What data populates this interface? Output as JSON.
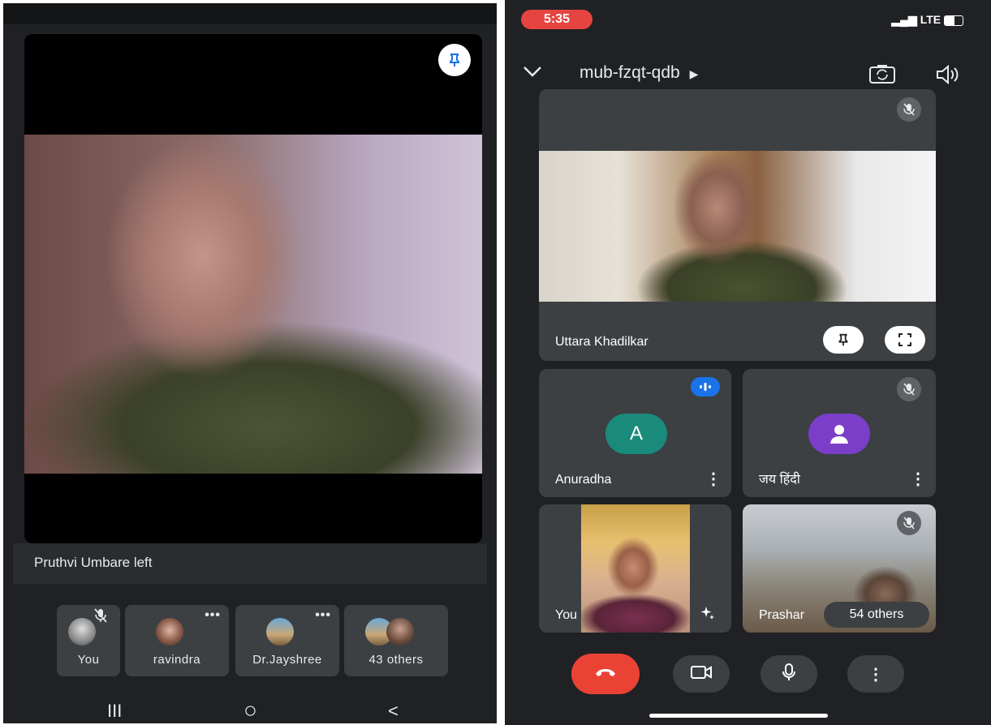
{
  "left_phone": {
    "notification": "Pruthvi Umbare left",
    "participants": [
      {
        "label": "You",
        "muted": true,
        "more": false
      },
      {
        "label": "ravindra",
        "muted": false,
        "more": true
      },
      {
        "label": "Dr.Jayshree",
        "muted": false,
        "more": true
      },
      {
        "label": "43 others",
        "muted": false,
        "more": false
      }
    ],
    "more_dots": "•••",
    "nav": {
      "recents": "III",
      "home": "○",
      "back": "<"
    }
  },
  "right_phone": {
    "status_bar": {
      "time": "5:35",
      "network": "LTE"
    },
    "meeting_code": "mub-fzqt-qdb",
    "featured": {
      "name": "Uttara Khadilkar"
    },
    "grid": [
      {
        "name": "Anuradha",
        "avatar_letter": "A",
        "avatar_color": "#1a8a7a",
        "speaking": true
      },
      {
        "name": "जय हिंदी",
        "avatar_color": "#7a3ec8",
        "muted": true
      },
      {
        "name": "You"
      },
      {
        "name": "Prashar",
        "others": "54 others",
        "muted": true
      }
    ],
    "more_v": "⋮"
  },
  "colors": {
    "bg": "#202124",
    "tile": "#3c4043",
    "end_call": "#ea4335",
    "accent": "#1a73e8"
  },
  "icons": [
    "pin-icon",
    "mic-off-icon",
    "chevron-down-icon",
    "camera-flip-icon",
    "speaker-icon",
    "fullscreen-icon",
    "end-call-icon",
    "video-icon",
    "mic-icon",
    "more-vertical-icon",
    "sparkle-icon",
    "speaking-indicator-icon"
  ]
}
